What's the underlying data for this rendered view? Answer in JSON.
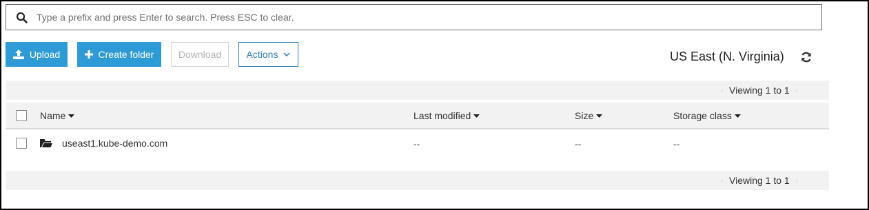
{
  "search": {
    "placeholder": "Type a prefix and press Enter to search. Press ESC to clear."
  },
  "toolbar": {
    "upload_label": "Upload",
    "create_folder_label": "Create folder",
    "download_label": "Download",
    "actions_label": "Actions"
  },
  "region": "US East (N. Virginia)",
  "pagination": {
    "top": "Viewing 1 to 1",
    "bottom": "Viewing 1 to 1"
  },
  "table": {
    "columns": [
      "Name",
      "Last modified",
      "Size",
      "Storage class"
    ],
    "rows": [
      {
        "name": "useast1.kube-demo.com",
        "last_modified": "--",
        "size": "--",
        "storage_class": "--",
        "type_icon": "folder-icon"
      }
    ]
  },
  "colors": {
    "primary": "#2e9bd6",
    "actions": "#2e7db5",
    "bar": "#f2f2f2"
  }
}
